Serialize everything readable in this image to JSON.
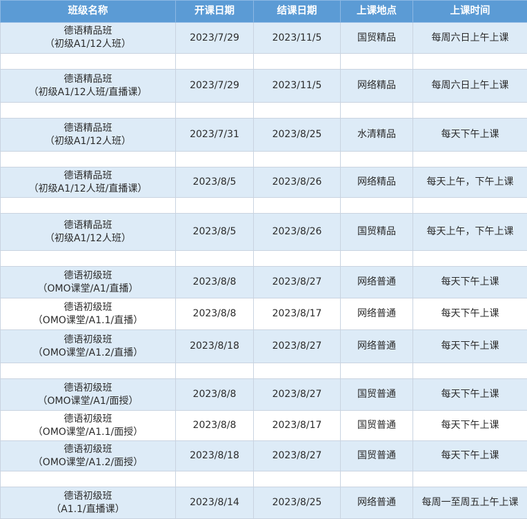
{
  "headers": [
    "班级名称",
    "开课日期",
    "结课日期",
    "上课地点",
    "上课时间"
  ],
  "rows": [
    {
      "type": "data",
      "style": "band",
      "name1": "德语精品班",
      "name2": "（初级A1/12人班）",
      "start": "2023/7/29",
      "end": "2023/11/5",
      "location": "国贸精品",
      "time": "每周六日上午上课"
    },
    {
      "type": "spacer"
    },
    {
      "type": "data",
      "style": "band",
      "name1": "德语精品班",
      "name2": "（初级A1/12人班/直播课）",
      "start": "2023/7/29",
      "end": "2023/11/5",
      "location": "网络精品",
      "time": "每周六日上午上课"
    },
    {
      "type": "spacer"
    },
    {
      "type": "data",
      "style": "band",
      "name1": "德语精品班",
      "name2": "（初级A1/12人班）",
      "start": "2023/7/31",
      "end": "2023/8/25",
      "location": "水清精品",
      "time": "每天下午上课"
    },
    {
      "type": "spacer"
    },
    {
      "type": "data",
      "style": "band",
      "name1": "德语精品班",
      "name2": "（初级A1/12人班/直播课）",
      "start": "2023/8/5",
      "end": "2023/8/26",
      "location": "网络精品",
      "time": "每天上午，下午上课"
    },
    {
      "type": "spacer"
    },
    {
      "type": "data",
      "style": "band",
      "name1": "德语精品班",
      "name2": "（初级A1/12人班）",
      "start": "2023/8/5",
      "end": "2023/8/26",
      "location": "国贸精品",
      "time": "每天上午，下午上课"
    },
    {
      "type": "spacer"
    },
    {
      "type": "data",
      "style": "band",
      "name1": "德语初级班",
      "name2": "（OMO课堂/A1/直播）",
      "start": "2023/8/8",
      "end": "2023/8/27",
      "location": "网络普通",
      "time": "每天下午上课"
    },
    {
      "type": "data",
      "style": "white",
      "name1": "德语初级班",
      "name2": "（OMO课堂/A1.1/直播）",
      "start": "2023/8/8",
      "end": "2023/8/17",
      "location": "网络普通",
      "time": "每天下午上课"
    },
    {
      "type": "data",
      "style": "band",
      "name1": "德语初级班",
      "name2": "（OMO课堂/A1.2/直播）",
      "start": "2023/8/18",
      "end": "2023/8/27",
      "location": "网络普通",
      "time": "每天下午上课"
    },
    {
      "type": "spacer"
    },
    {
      "type": "data",
      "style": "band",
      "name1": "德语初级班",
      "name2": "（OMO课堂/A1/面授）",
      "start": "2023/8/8",
      "end": "2023/8/27",
      "location": "国贸普通",
      "time": "每天下午上课"
    },
    {
      "type": "data",
      "style": "white",
      "name1": "德语初级班",
      "name2": "（OMO课堂/A1.1/面授）",
      "start": "2023/8/8",
      "end": "2023/8/17",
      "location": "国贸普通",
      "time": "每天下午上课"
    },
    {
      "type": "data",
      "style": "band",
      "name1": "德语初级班",
      "name2": "（OMO课堂/A1.2/面授）",
      "start": "2023/8/18",
      "end": "2023/8/27",
      "location": "国贸普通",
      "time": "每天下午上课"
    },
    {
      "type": "spacer"
    },
    {
      "type": "data",
      "style": "band",
      "name1": "德语初级班",
      "name2": "（A1.1/直播课）",
      "start": "2023/8/14",
      "end": "2023/8/25",
      "location": "网络普通",
      "time": "每周一至周五上午上课"
    }
  ]
}
